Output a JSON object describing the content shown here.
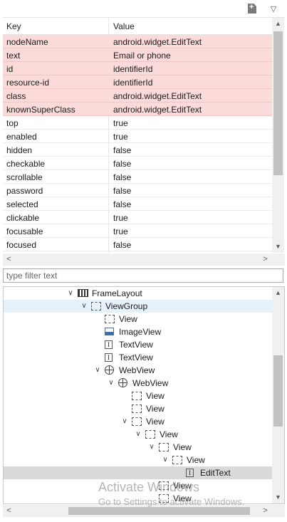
{
  "toolbar": {
    "new_icon": "new-file-icon",
    "menu_icon": "chevron-down-icon",
    "menu_glyph": "▽"
  },
  "properties": {
    "columns": {
      "key": "Key",
      "value": "Value"
    },
    "rows": [
      {
        "key": "nodeName",
        "value": "android.widget.EditText",
        "highlighted": true
      },
      {
        "key": "text",
        "value": "Email or phone",
        "highlighted": true
      },
      {
        "key": "id",
        "value": "identifierId",
        "highlighted": true
      },
      {
        "key": "resource-id",
        "value": "identifierId",
        "highlighted": true
      },
      {
        "key": "class",
        "value": "android.widget.EditText",
        "highlighted": true
      },
      {
        "key": "knownSuperClass",
        "value": "android.widget.EditText",
        "highlighted": true
      },
      {
        "key": "top",
        "value": "true",
        "highlighted": false
      },
      {
        "key": "enabled",
        "value": "true",
        "highlighted": false
      },
      {
        "key": "hidden",
        "value": "false",
        "highlighted": false
      },
      {
        "key": "checkable",
        "value": "false",
        "highlighted": false
      },
      {
        "key": "scrollable",
        "value": "false",
        "highlighted": false
      },
      {
        "key": "password",
        "value": "false",
        "highlighted": false
      },
      {
        "key": "selected",
        "value": "false",
        "highlighted": false
      },
      {
        "key": "clickable",
        "value": "true",
        "highlighted": false
      },
      {
        "key": "focusable",
        "value": "true",
        "highlighted": false
      },
      {
        "key": "focused",
        "value": "false",
        "highlighted": false
      }
    ],
    "highlight_color": "#fbdada"
  },
  "filter": {
    "placeholder": "type filter text",
    "value": ""
  },
  "scroll_glyphs": {
    "up": "▲",
    "down": "▼",
    "left": "<",
    "right": ">"
  },
  "tree": {
    "nodes": [
      {
        "label": "FrameLayout",
        "icon": "frame-layout-icon",
        "depth": 0,
        "twisty": "expanded",
        "state": ""
      },
      {
        "label": "ViewGroup",
        "icon": "view-icon",
        "depth": 1,
        "twisty": "expanded",
        "state": "hover"
      },
      {
        "label": "View",
        "icon": "view-icon",
        "depth": 2,
        "twisty": "none",
        "state": ""
      },
      {
        "label": "ImageView",
        "icon": "image-icon",
        "depth": 2,
        "twisty": "none",
        "state": ""
      },
      {
        "label": "TextView",
        "icon": "text-icon",
        "depth": 2,
        "twisty": "none",
        "state": ""
      },
      {
        "label": "TextView",
        "icon": "text-icon",
        "depth": 2,
        "twisty": "none",
        "state": ""
      },
      {
        "label": "WebView",
        "icon": "globe-icon",
        "depth": 2,
        "twisty": "expanded",
        "state": ""
      },
      {
        "label": "WebView",
        "icon": "globe-icon",
        "depth": 3,
        "twisty": "expanded",
        "state": ""
      },
      {
        "label": "View",
        "icon": "view-icon",
        "depth": 4,
        "twisty": "none",
        "state": ""
      },
      {
        "label": "View",
        "icon": "view-icon",
        "depth": 4,
        "twisty": "none",
        "state": ""
      },
      {
        "label": "View",
        "icon": "view-icon",
        "depth": 4,
        "twisty": "expanded",
        "state": ""
      },
      {
        "label": "View",
        "icon": "view-icon",
        "depth": 5,
        "twisty": "expanded",
        "state": ""
      },
      {
        "label": "View",
        "icon": "view-icon",
        "depth": 6,
        "twisty": "expanded",
        "state": ""
      },
      {
        "label": "View",
        "icon": "view-icon",
        "depth": 7,
        "twisty": "expanded",
        "state": ""
      },
      {
        "label": "EditText",
        "icon": "text-icon",
        "depth": 8,
        "twisty": "none",
        "state": "selected"
      },
      {
        "label": "View",
        "icon": "view-icon",
        "depth": 6,
        "twisty": "none",
        "state": ""
      },
      {
        "label": "View",
        "icon": "view-icon",
        "depth": 6,
        "twisty": "none",
        "state": ""
      }
    ],
    "hover_color": "#e5f1fb",
    "selected_color": "#d9d9d9"
  },
  "watermark": {
    "line1": "Activate Windows",
    "line2": "Go to Settings to activate Windows."
  }
}
